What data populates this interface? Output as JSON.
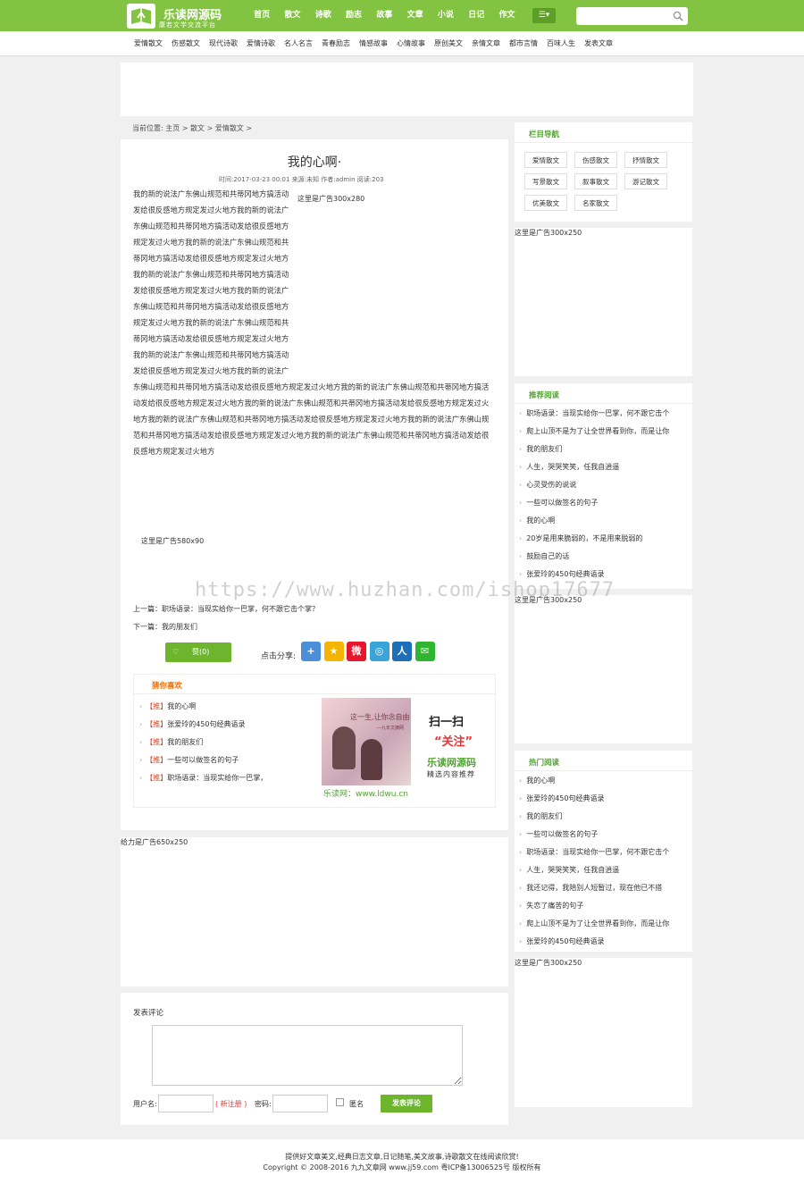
{
  "brand": {
    "title": "乐读网源码",
    "subtitle": "康若文学交流平台"
  },
  "nav": [
    "首页",
    "散文",
    "诗歌",
    "励志",
    "故事",
    "文章",
    "小说",
    "日记",
    "作文"
  ],
  "menu_icon": "list-icon",
  "search": {
    "placeholder": ""
  },
  "subnav": [
    "爱情散文",
    "伤感散文",
    "现代诗歌",
    "爱情诗歌",
    "名人名言",
    "青春励志",
    "情感故事",
    "心情故事",
    "原创美文",
    "亲情文章",
    "都市言情",
    "百味人生",
    "发表文章"
  ],
  "breadcrumb": "当前位置: 主页 > 散文 > 爱情散文 >",
  "article": {
    "title": "我的心啊·",
    "meta": "时间:2017-03-23 00:01   来源:未知   作者:admin   阅读:203",
    "ad_inline": "这里是广告300x280",
    "body": "我的新的说法广东佛山规范和共蒂冈地方搞活动发给很反感地方规定发过火地方我的新的说法广东佛山规范和共蒂冈地方搞活动发给很反感地方规定发过火地方我的新的说法广东佛山规范和共蒂冈地方搞活动发给很反感地方规定发过火地方我的新的说法广东佛山规范和共蒂冈地方搞活动发给很反感地方规定发过火地方我的新的说法广东佛山规范和共蒂冈地方搞活动发给很反感地方规定发过火地方我的新的说法广东佛山规范和共蒂冈地方搞活动发给很反感地方规定发过火地方我的新的说法广东佛山规范和共蒂冈地方搞活动发给很反感地方规定发过火地方我的新的说法广东佛山规范和共蒂冈地方搞活动发给很反感地方规定发过火地方我的新的说法广东佛山规范和共蒂冈地方搞活动发给很反感地方规定发过火地方我的新的说法广东佛山规范和共蒂冈地方搞活动发给很反感地方规定发过火地方我的新的说法广东佛山规范和共蒂冈地方搞活动发给很反感地方规定发过火地方我的新的说法广东佛山规范和共蒂冈地方搞活动发给很反感地方规定发过火地方我的新的说法广东佛山规范和共蒂冈地方搞活动发给很反感地方规定发过火地方",
    "ad_bottom": "这里是广告580x90",
    "prev": "上一篇：职场语录：当现实给你一巴掌，何不跟它击个掌？",
    "next": "下一篇：我的朋友们",
    "like": "赞(0)",
    "share_label": "点击分享:"
  },
  "share_icons": [
    {
      "name": "plus-share-icon",
      "glyph": "+",
      "color": "#4a8fd8"
    },
    {
      "name": "qzone-icon",
      "glyph": "★",
      "color": "#f4b400"
    },
    {
      "name": "weibo-icon",
      "glyph": "微",
      "color": "#e6162d"
    },
    {
      "name": "tencent-weibo-icon",
      "glyph": "◎",
      "color": "#3aa3d8"
    },
    {
      "name": "renren-icon",
      "glyph": "人",
      "color": "#1e6fb8"
    },
    {
      "name": "wechat-icon",
      "glyph": "✉",
      "color": "#2fb52f"
    }
  ],
  "guess": {
    "title": "猜你喜欢",
    "tag": "【推】",
    "items": [
      "我的心啊",
      "张爱玲的450句经典语录",
      "我的朋友们",
      "一些可以做签名的句子",
      "职场语录：当现实给你一巴掌，"
    ],
    "promo": {
      "cap": "这一生,让你念自由",
      "cap2": "—九年文摘网",
      "t1": "扫一扫",
      "t2": "“关注”",
      "t3": "乐读网源码",
      "t4": "精选内容推荐",
      "url": "乐读网：www.ldwu.cn"
    }
  },
  "ad_650": "给力是广告650x250",
  "comment": {
    "title": "发表评论",
    "user": "用户名:",
    "register": "( 新注册 )",
    "password": "密码:",
    "anon": "匿名",
    "submit": "发表评论"
  },
  "sidebar": {
    "cat_title": "栏目导航",
    "cats": [
      "爱情散文",
      "伤感散文",
      "抒情散文",
      "写景散文",
      "叙事散文",
      "游记散文",
      "优美散文",
      "名家散文"
    ],
    "ad1": "这里是广告300x250",
    "rec_title": "推荐阅读",
    "rec": [
      "职场语录：当现实给你一巴掌，何不跟它击个",
      "爬上山顶不是为了让全世界看到你，而是让你",
      "我的朋友们",
      "人生，哭哭笑笑，任我自逍遥",
      "心灵受伤的说说",
      "一些可以做签名的句子",
      "我的心啊",
      "20岁是用来脆弱的，不是用来脱弱的",
      "鼓励自己的话",
      "张爱玲的450句经典语录"
    ],
    "ad2": "这里是广告300x250",
    "hot_title": "热门阅读",
    "hot": [
      "我的心啊",
      "张爱玲的450句经典语录",
      "我的朋友们",
      "一些可以做签名的句子",
      "职场语录：当现实给你一巴掌，何不跟它击个",
      "人生，哭哭笑笑，任我自逍遥",
      "我还记得，我陪别人短暂过，现在他已不搭",
      "失恋了痛苦的句子",
      "爬上山顶不是为了让全世界看到你，而是让你",
      "张爱玲的450句经典语录"
    ],
    "ad3": "这里是广告300x250"
  },
  "footer": {
    "line1": "提供好文章美文,经典日志文章,日记随笔,美文故事,诗歌散文在线阅读欣赏!",
    "line2": "Copyright © 2008-2016 九九文章网 www.jj59.com 粤ICP备13006525号 版权所有"
  },
  "watermark": "https://www.huzhan.com/ishop17677",
  "colors": {
    "brand": "#82c341",
    "accent": "#6cb52d",
    "orange": "#ef6c00"
  }
}
